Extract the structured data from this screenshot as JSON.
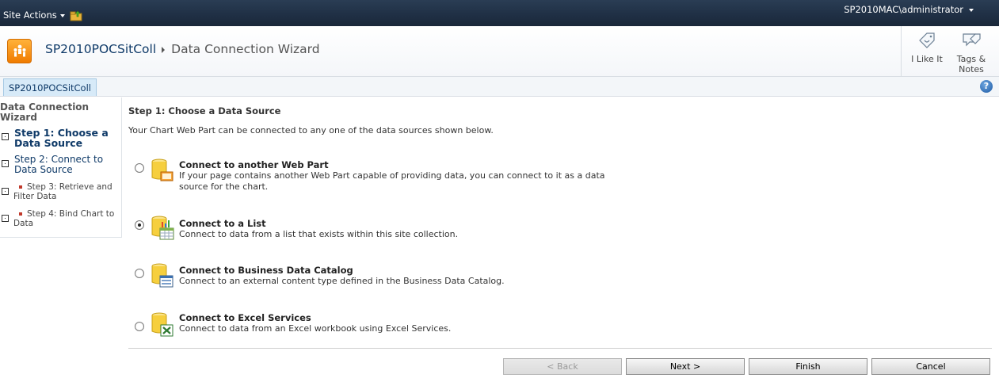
{
  "topbar": {
    "site_actions_label": "Site Actions",
    "user_label": "SP2010MAC\\administrator"
  },
  "header": {
    "site_title": "SP2010POCSitColl",
    "page_title": "Data Connection Wizard",
    "like_label": "I Like It",
    "tags_label_line1": "Tags &",
    "tags_label_line2": "Notes"
  },
  "nav": {
    "tab_label": "SP2010POCSitColl",
    "help_label": "?"
  },
  "leftnav": {
    "title": "Data Connection Wizard",
    "steps": [
      {
        "label": "Step 1: Choose a Data Source"
      },
      {
        "label": "Step 2: Connect to Data Source"
      },
      {
        "label": "Step 3: Retrieve and Filter Data"
      },
      {
        "label": "Step 4: Bind Chart to Data"
      }
    ]
  },
  "main": {
    "heading": "Step 1: Choose a Data Source",
    "description": "Your Chart Web Part can be connected to any one of the data sources shown below.",
    "selected_option": "list",
    "options": [
      {
        "id": "webpart",
        "title": "Connect to another Web Part",
        "desc": "If your page contains another Web Part capable of providing data, you can connect to it as a data source for the chart.",
        "icon": "web-part-data-icon",
        "checked": false
      },
      {
        "id": "list",
        "title": "Connect to a List",
        "desc": "Connect to data from a list that exists within this site collection.",
        "icon": "list-data-icon",
        "checked": true
      },
      {
        "id": "bdc",
        "title": "Connect to Business Data Catalog",
        "desc": "Connect to an external content type defined in the Business Data Catalog.",
        "icon": "bdc-data-icon",
        "checked": false
      },
      {
        "id": "excel",
        "title": "Connect to Excel Services",
        "desc": "Connect to data from an Excel workbook using Excel Services.",
        "icon": "excel-data-icon",
        "checked": false
      }
    ]
  },
  "buttons": {
    "back": "< Back",
    "next": "Next >",
    "finish": "Finish",
    "cancel": "Cancel"
  },
  "colors": {
    "topbar": "#1f2f44",
    "link": "#0f3a68",
    "accent_orange": "#f07b00"
  }
}
